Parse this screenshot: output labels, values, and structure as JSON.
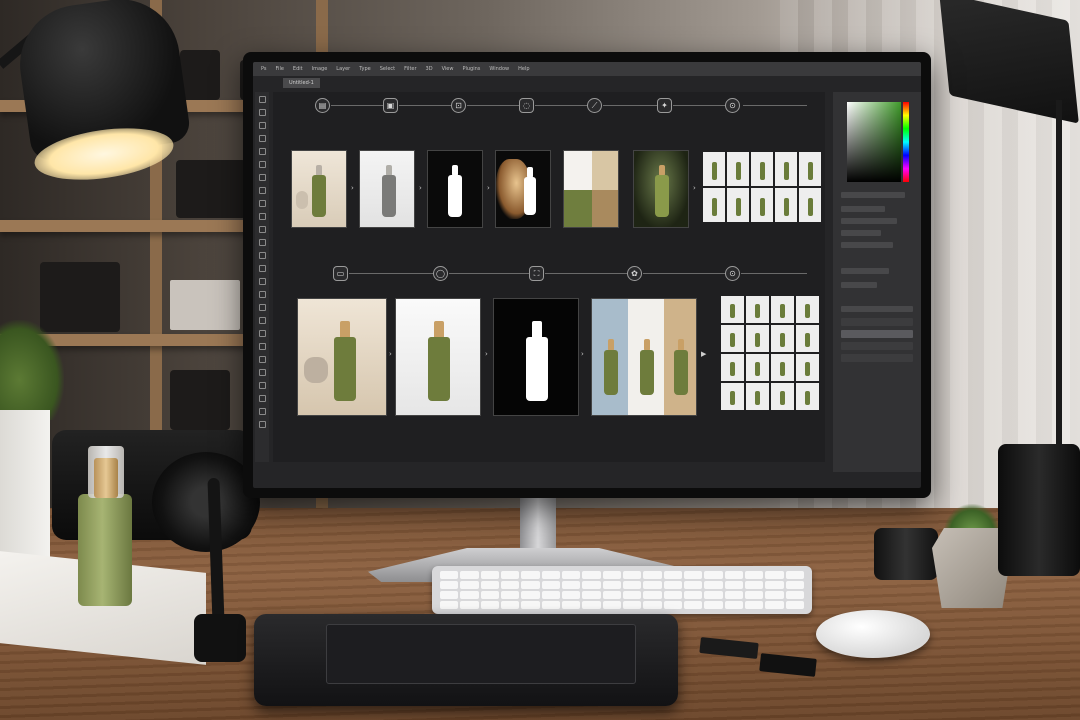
{
  "scene": {
    "description_items": [
      "desk-lamp",
      "bookshelf",
      "studio-softbox",
      "light-stand",
      "monitor",
      "keyboard",
      "pen-tablet",
      "stylus",
      "mouse",
      "sd-cards",
      "camera",
      "camera-lenses",
      "product-bottle",
      "marble-block",
      "potted-plant",
      "succulent"
    ]
  },
  "app": {
    "menu": [
      "Ps",
      "File",
      "Edit",
      "Image",
      "Layer",
      "Type",
      "Select",
      "Filter",
      "3D",
      "View",
      "Plugins",
      "Window",
      "Help"
    ],
    "document_tab": "Untitled-1"
  },
  "workflow": {
    "row1_steps": [
      {
        "icon": "document-icon",
        "glyph": "▤"
      },
      {
        "icon": "frame-icon",
        "glyph": "▣"
      },
      {
        "icon": "crop-icon",
        "glyph": "⊡"
      },
      {
        "icon": "shield-icon",
        "glyph": "◌"
      },
      {
        "icon": "wand-icon",
        "glyph": "⟋"
      },
      {
        "icon": "retouch-icon",
        "glyph": "✦"
      },
      {
        "icon": "export-icon",
        "glyph": "⊙"
      }
    ],
    "row2_steps": [
      {
        "icon": "image-icon",
        "glyph": "▭"
      },
      {
        "icon": "chat-icon",
        "glyph": "◯"
      },
      {
        "icon": "resize-icon",
        "glyph": "⛶"
      },
      {
        "icon": "flower-icon",
        "glyph": "✿"
      },
      {
        "icon": "export-icon",
        "glyph": "⊙"
      }
    ],
    "arrow_glyph": "›",
    "play_glyph": "▶"
  },
  "colors": {
    "bottle_green": "#6e7c3c",
    "bottle_cap_gold": "#c9a066",
    "screen_bg": "#1f1f21"
  }
}
